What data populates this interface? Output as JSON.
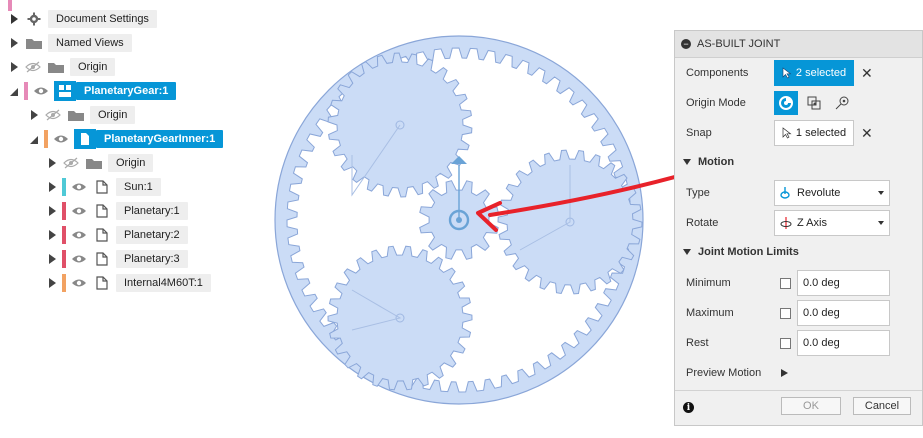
{
  "tree": {
    "items": [
      {
        "label": "Document Settings"
      },
      {
        "label": "Named Views"
      },
      {
        "label": "Origin"
      },
      {
        "label": "PlanetaryGear:1"
      },
      {
        "label": "Origin"
      },
      {
        "label": "PlanetaryGearInner:1"
      },
      {
        "label": "Origin"
      },
      {
        "label": "Sun:1"
      },
      {
        "label": "Planetary:1"
      },
      {
        "label": "Planetary:2"
      },
      {
        "label": "Planetary:3"
      },
      {
        "label": "Internal4M60T:1"
      }
    ]
  },
  "colors": {
    "accent": "#0696d7",
    "gear_fill": "#cbdcf6",
    "gear_stroke": "#8aa6d8",
    "annotation": "#e8222a",
    "sun_bar": "#4fc9d6",
    "planet_bar": "#e05068",
    "internal_bar": "#f2a262",
    "parent_bar": "#e68ab8"
  },
  "dialog": {
    "title": "AS-BUILT JOINT",
    "components_label": "Components",
    "components_value": "2 selected",
    "origin_mode_label": "Origin Mode",
    "snap_label": "Snap",
    "snap_value": "1 selected",
    "motion_section": "Motion",
    "type_label": "Type",
    "type_value": "Revolute",
    "rotate_label": "Rotate",
    "rotate_value": "Z Axis",
    "limits_section": "Joint Motion Limits",
    "min_label": "Minimum",
    "min_value": "0.0 deg",
    "max_label": "Maximum",
    "max_value": "0.0 deg",
    "rest_label": "Rest",
    "rest_value": "0.0 deg",
    "preview_label": "Preview Motion",
    "ok": "OK",
    "cancel": "Cancel",
    "info": "i",
    "clear": "✕"
  }
}
